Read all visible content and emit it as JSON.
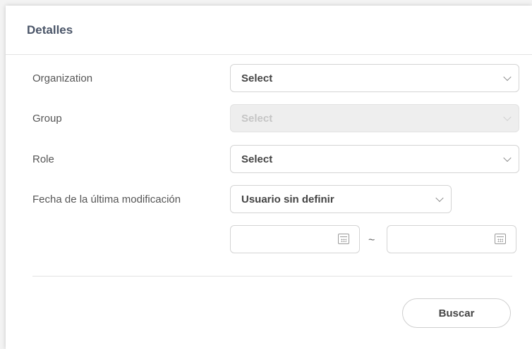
{
  "panel": {
    "title": "Detalles"
  },
  "fields": {
    "organization": {
      "label": "Organization",
      "value": "Select"
    },
    "group": {
      "label": "Group",
      "value": "Select",
      "disabled": true
    },
    "role": {
      "label": "Role",
      "value": "Select"
    },
    "last_modified": {
      "label": "Fecha de la última modificación",
      "value": "Usuario sin definir"
    }
  },
  "date_range": {
    "from": "",
    "to": "",
    "separator": "~"
  },
  "actions": {
    "search_label": "Buscar"
  },
  "colors": {
    "border": "#d4d4d4",
    "disabled_bg": "#eeeeee",
    "title": "#4a5568"
  },
  "icons": {
    "dropdown": "chevron-down-icon",
    "calendar": "calendar-icon"
  }
}
